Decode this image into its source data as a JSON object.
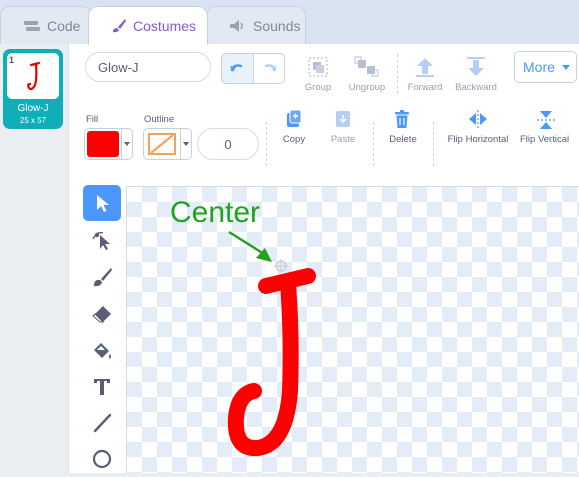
{
  "tabs": [
    {
      "label": "Code",
      "icon": "code-icon"
    },
    {
      "label": "Costumes",
      "icon": "brush-icon",
      "active": true
    },
    {
      "label": "Sounds",
      "icon": "speaker-icon"
    }
  ],
  "costume_list": {
    "items": [
      {
        "number": "1",
        "name": "Glow-J",
        "size": "25 x 57",
        "selected": true
      }
    ]
  },
  "editor": {
    "costume_name": "Glow-J",
    "toolbar": {
      "group": "Group",
      "ungroup": "Ungroup",
      "forward": "Forward",
      "backward": "Backward",
      "more": "More"
    },
    "fill_label": "Fill",
    "outline_label": "Outline",
    "outline_width": "0",
    "actions": {
      "copy": "Copy",
      "paste": "Paste",
      "delete": "Delete",
      "flip_horizontal": "Flip Horizontal",
      "flip_vertical": "Flip Vertical"
    },
    "annotation": "Center"
  },
  "colors": {
    "accent": "#4c97ff",
    "tab_active": "#855cd6",
    "selected_costume": "#10aeb9",
    "fill_color": "#ff0000",
    "annotation": "#23a21f"
  },
  "tools": [
    "select-icon",
    "reshape-icon",
    "brush-icon",
    "eraser-icon",
    "fill-icon",
    "text-icon",
    "line-icon",
    "circle-icon"
  ]
}
